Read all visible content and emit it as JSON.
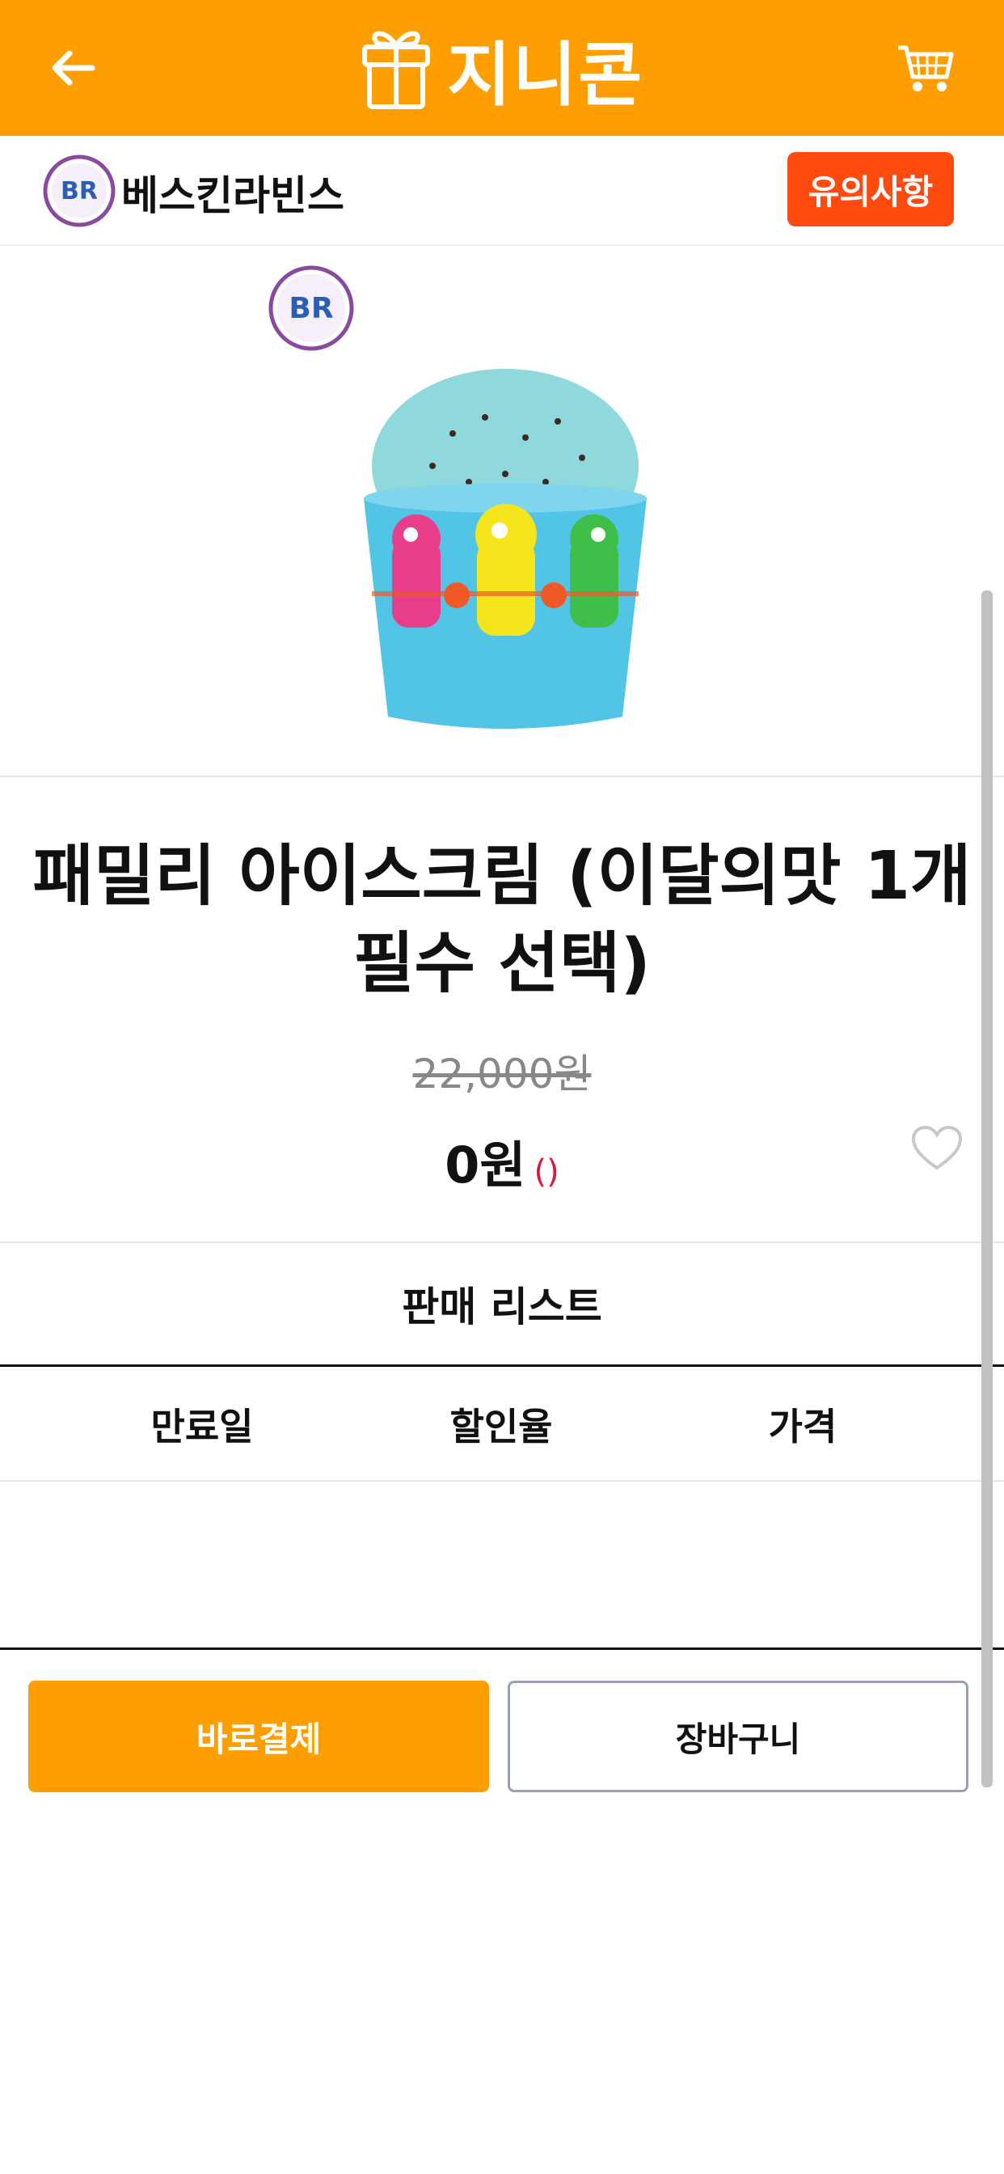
{
  "app": {
    "title": "지니콘",
    "brand_color": "#FF9E00"
  },
  "header": {
    "back_icon": "arrow-left-icon",
    "logo_icon": "gift-box-icon",
    "cart_icon": "shopping-cart-icon"
  },
  "brand": {
    "name": "베스킨라빈스",
    "logo_text": "BR",
    "notice_label": "유의사항",
    "notice_color": "#FF4A10"
  },
  "product": {
    "title": "패밀리 아이스크림 (이달의맛 1개 필수 선택)",
    "original_price": "22,000원",
    "price": "0원",
    "price_note": "()",
    "favorite_icon": "heart-outline-icon"
  },
  "sales_list": {
    "title": "판매 리스트",
    "columns": [
      "만료일",
      "할인율",
      "가격"
    ],
    "rows": []
  },
  "actions": {
    "buy_now_label": "바로결제",
    "add_to_cart_label": "장바구니"
  }
}
